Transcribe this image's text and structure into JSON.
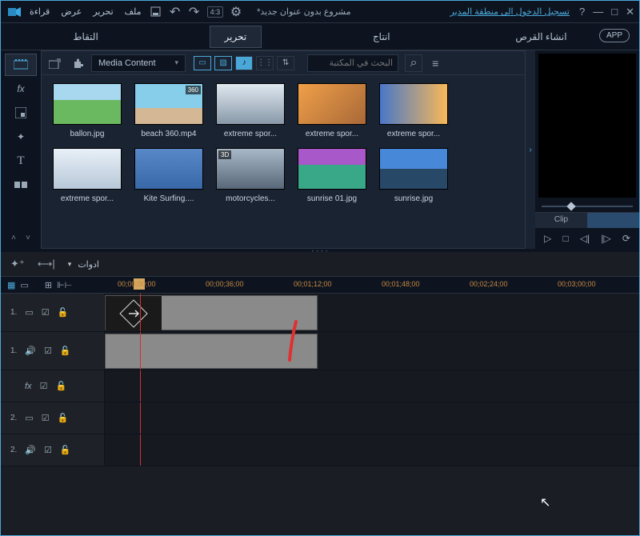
{
  "menu": {
    "file": "ملف",
    "edit": "تحرير",
    "view": "عرض",
    "play": "قراءة"
  },
  "aspect": "4:3",
  "project_title": "مشروع بدون عنوان جديد*",
  "signin": "تسجيل الدخول الى منطقة المدير",
  "tabs": {
    "capture": "التقاط",
    "edit": "تحرير",
    "produce": "انتاج",
    "disc": "انشاء القرص"
  },
  "app_badge": "APP",
  "dropdown": "Media Content",
  "search_placeholder": "البحث في المكتبة",
  "thumbs": [
    {
      "label": "ballon.jpg"
    },
    {
      "label": "beach 360.mp4",
      "b360": "360"
    },
    {
      "label": "extreme spor..."
    },
    {
      "label": "extreme spor..."
    },
    {
      "label": "extreme spor..."
    },
    {
      "label": "extreme spor..."
    },
    {
      "label": "Kite Surfing...."
    },
    {
      "label": "motorcycles...",
      "b3d": "3D"
    },
    {
      "label": "sunrise 01.jpg"
    },
    {
      "label": "sunrise.jpg"
    }
  ],
  "clip_tab": "Clip",
  "tools_label": "ادوات",
  "ticks": [
    "00;00;00;00",
    "00;00;36;00",
    "00;01;12;00",
    "00;01;48;00",
    "00;02;24;00",
    "00;03;00;00"
  ],
  "tracks": {
    "v1": "1.",
    "a1": "1.",
    "fx": "",
    "v2": "2.",
    "a2": "2."
  },
  "rail_fx": "fx",
  "rail_t": "T",
  "track_fx": "fx"
}
